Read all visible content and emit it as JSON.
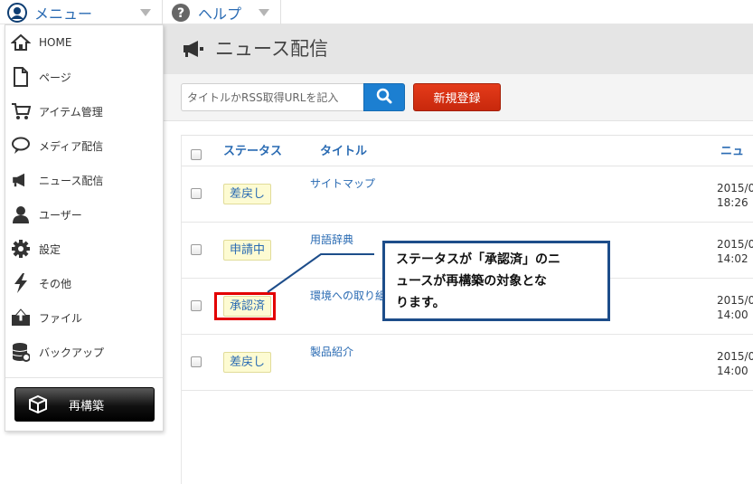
{
  "topbar": {
    "menu_label": "メニュー",
    "help_label": "ヘルプ"
  },
  "sidemenu": {
    "items": [
      {
        "label": "HOME",
        "icon": "home-icon"
      },
      {
        "label": "ページ",
        "icon": "page-icon"
      },
      {
        "label": "アイテム管理",
        "icon": "cart-icon"
      },
      {
        "label": "メディア配信",
        "icon": "speech-bubble-icon"
      },
      {
        "label": "ニュース配信",
        "icon": "megaphone-icon"
      },
      {
        "label": "ユーザー",
        "icon": "user-icon"
      },
      {
        "label": "設定",
        "icon": "gear-icon"
      },
      {
        "label": "その他",
        "icon": "lightning-icon"
      },
      {
        "label": "ファイル",
        "icon": "upload-icon"
      },
      {
        "label": "バックアップ",
        "icon": "database-icon"
      }
    ],
    "rebuild_label": "再構築"
  },
  "page": {
    "title": "ニュース配信"
  },
  "search": {
    "placeholder": "タイトルかRSS取得URLを記入"
  },
  "toolbar": {
    "new_label": "新規登録"
  },
  "table": {
    "headers": {
      "status": "ステータス",
      "title": "タイトル",
      "date": "ニュー"
    },
    "rows": [
      {
        "status": "差戻し",
        "title": "サイトマップ",
        "date1": "2015/0",
        "date2": "18:26"
      },
      {
        "status": "申請中",
        "title": "用語辞典",
        "date1": "2015/0",
        "date2": "14:02"
      },
      {
        "status": "承認済",
        "title": "環境への取り組",
        "date1": "2015/0",
        "date2": "14:00"
      },
      {
        "status": "差戻し",
        "title": "製品紹介",
        "date1": "2015/0",
        "date2": "14:00"
      }
    ]
  },
  "callout": {
    "line1": "ステータスが「承認済」のニ",
    "line2": "ュースが再構築の対象とな",
    "line3": "ります。"
  },
  "colors": {
    "accent_blue": "#2a6bb3",
    "search_blue": "#1c7fd1",
    "new_red": "#d8300f",
    "highlight_red": "#e30000",
    "callout_border": "#1d4d8a",
    "badge_bg": "#fdfbd2"
  }
}
